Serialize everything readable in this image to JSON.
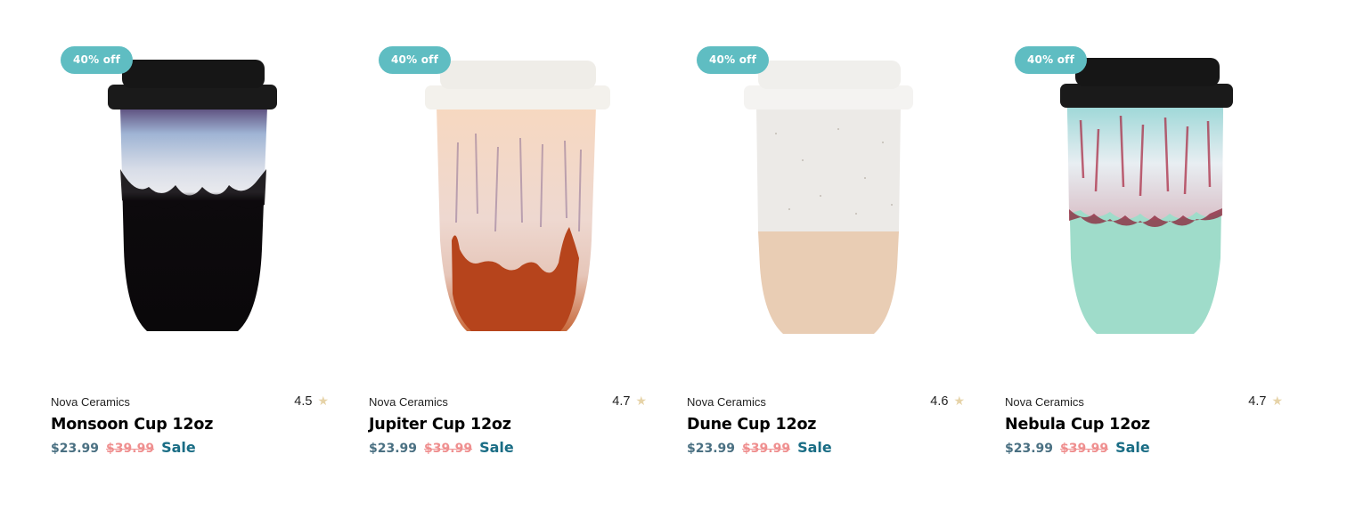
{
  "products": [
    {
      "badge": "40% off",
      "brand": "Nova Ceramics",
      "rating": "4.5",
      "rating_star": "★",
      "name": "Monsoon Cup 12oz",
      "price": "$23.99",
      "old_price": "$39.99",
      "sale_label": "Sale",
      "colors": {
        "lid": "#1a1a1a",
        "top": "#8fa6c8",
        "accent": "#6b4a7a",
        "bottom": "#0d0a0d"
      }
    },
    {
      "badge": "40% off",
      "brand": "Nova Ceramics",
      "rating": "4.7",
      "rating_star": "★",
      "name": "Jupiter Cup 12oz",
      "price": "$23.99",
      "old_price": "$39.99",
      "sale_label": "Sale",
      "colors": {
        "lid": "#f3f1ec",
        "top": "#f5dcc6",
        "accent": "#8a6b8f",
        "bottom": "#b94a1d"
      }
    },
    {
      "badge": "40% off",
      "brand": "Nova Ceramics",
      "rating": "4.6",
      "rating_star": "★",
      "name": "Dune Cup 12oz",
      "price": "$23.99",
      "old_price": "$39.99",
      "sale_label": "Sale",
      "colors": {
        "lid": "#f4f3f1",
        "top": "#ecebe8",
        "accent": "#c9b9a4",
        "bottom": "#e8cdb5"
      }
    },
    {
      "badge": "40% off",
      "brand": "Nova Ceramics",
      "rating": "4.7",
      "rating_star": "★",
      "name": "Nebula Cup 12oz",
      "price": "$23.99",
      "old_price": "$39.99",
      "sale_label": "Sale",
      "colors": {
        "lid": "#1a1a1a",
        "top": "#dde8ee",
        "accent": "#a8243e",
        "bottom": "#9fdcca"
      }
    }
  ]
}
